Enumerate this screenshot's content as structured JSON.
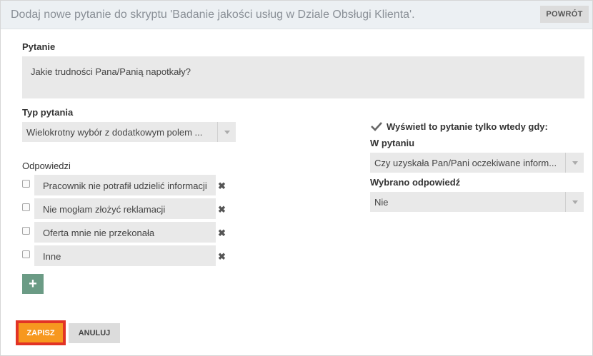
{
  "header": {
    "title": "Dodaj nowe pytanie do skryptu 'Badanie jakości usług w Dziale Obsługi Klienta'.",
    "back_label": "POWRÓT"
  },
  "question": {
    "label": "Pytanie",
    "value": "Jakie trudności Pana/Panią napotkały?"
  },
  "question_type": {
    "label": "Typ pytania",
    "selected": "Wielokrotny wybór z dodatkowym polem ..."
  },
  "answers": {
    "label": "Odpowiedzi",
    "items": [
      {
        "text": "Pracownik nie potrafił udzielić informacji"
      },
      {
        "text": "Nie mogłam złożyć reklamacji"
      },
      {
        "text": "Oferta mnie nie przekonała"
      },
      {
        "text": "Inne"
      }
    ],
    "remove_glyph": "✖",
    "add_glyph": "+"
  },
  "condition": {
    "checkbox_label": "Wyświetl to pytanie tylko wtedy gdy:",
    "checked": true,
    "in_question_label": "W pytaniu",
    "in_question_selected": "Czy uzyskała Pan/Pani oczekiwane inform...",
    "answer_label": "Wybrano odpowiedź",
    "answer_selected": "Nie"
  },
  "actions": {
    "save_label": "ZAPISZ",
    "cancel_label": "ANULUJ"
  },
  "colors": {
    "add_button": "#6b9b85",
    "save_button": "#f7981f",
    "save_highlight": "#e23325",
    "header_bg": "#ecf0f3"
  },
  "icons": [
    "check-icon",
    "remove-icon",
    "plus-icon",
    "chevron-down-icon"
  ]
}
